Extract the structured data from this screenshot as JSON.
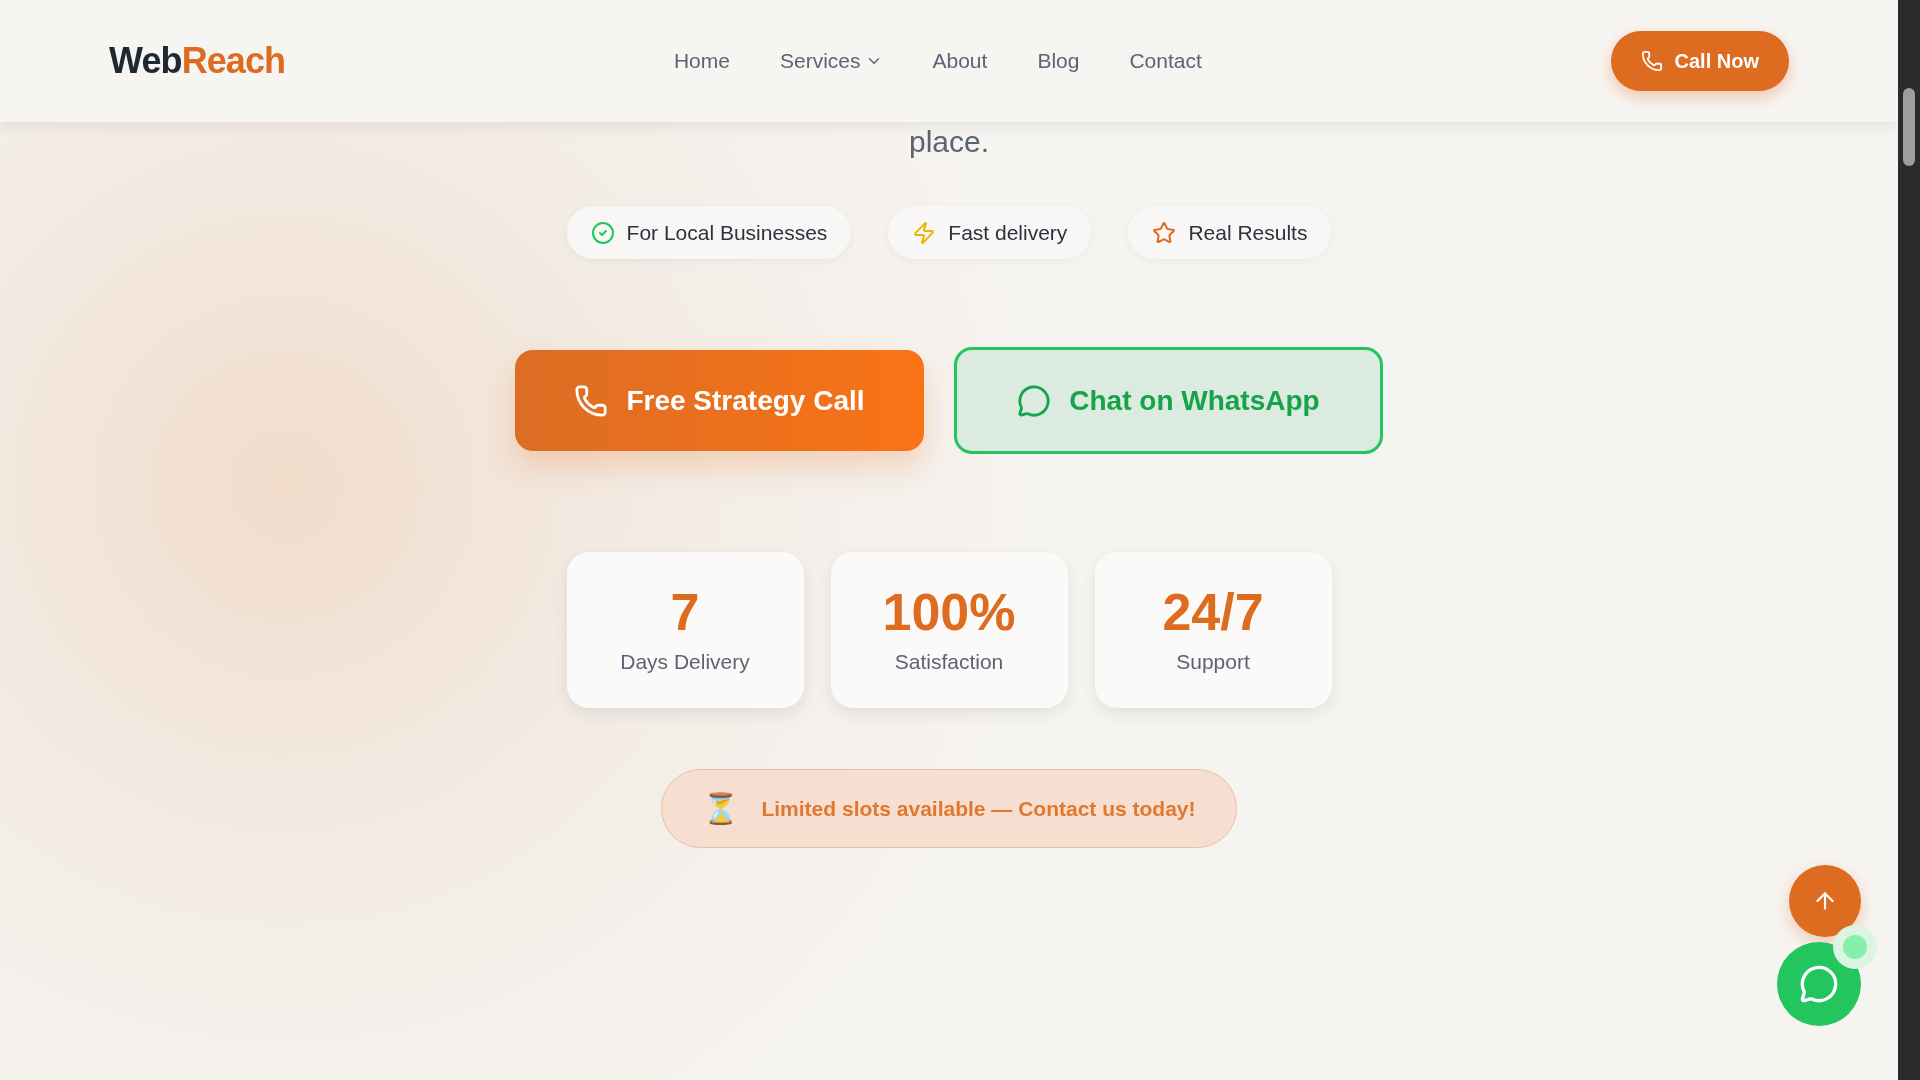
{
  "header": {
    "logo": {
      "first": "Web",
      "second": "Reach"
    },
    "nav": [
      {
        "label": "Home",
        "has_menu": false
      },
      {
        "label": "Services",
        "has_menu": true
      },
      {
        "label": "About",
        "has_menu": false
      },
      {
        "label": "Blog",
        "has_menu": false
      },
      {
        "label": "Contact",
        "has_menu": false
      }
    ],
    "cta": "Call Now"
  },
  "hero": {
    "tail_text": "place.",
    "badges": [
      {
        "label": "For Local Businesses",
        "kind": "check",
        "color": "#22c55e"
      },
      {
        "label": "Fast delivery",
        "kind": "bolt",
        "color": "#eab308"
      },
      {
        "label": "Real Results",
        "kind": "star",
        "color": "#dd6b20"
      }
    ],
    "primary_button": "Free Strategy Call",
    "secondary_button": "Chat on WhatsApp",
    "stats": [
      {
        "value": "7",
        "label": "Days Delivery"
      },
      {
        "value": "100%",
        "label": "Satisfaction"
      },
      {
        "value": "24/7",
        "label": "Support"
      }
    ],
    "notice": {
      "icon": "⏳",
      "text": "Limited slots available — Contact us today!"
    }
  }
}
